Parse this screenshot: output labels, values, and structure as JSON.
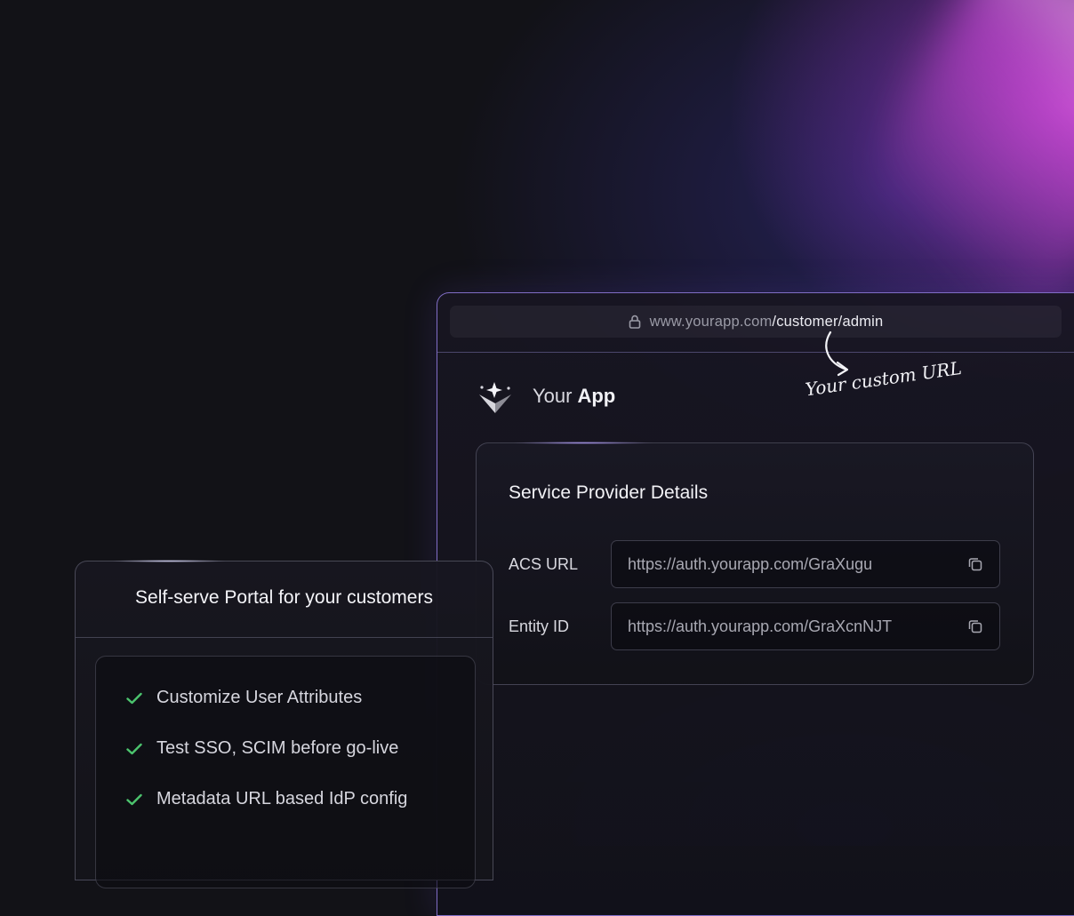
{
  "browser": {
    "url_host": "www.yourapp.com",
    "url_path": "/customer/admin",
    "annotation": "Your custom URL"
  },
  "brand": {
    "light": "Your",
    "bold": "App"
  },
  "service_provider": {
    "title": "Service Provider Details",
    "fields": [
      {
        "label": "ACS URL",
        "value": "https://auth.yourapp.com/GraXugu",
        "icon": "copy-icon"
      },
      {
        "label": "Entity ID",
        "value": "https://auth.yourapp.com/GraXcnNJT",
        "icon": "copy-icon"
      }
    ]
  },
  "portal": {
    "title": "Self-serve Portal for your customers",
    "features": [
      "Customize User Attributes",
      "Test SSO, SCIM before go-live",
      "Metadata URL based IdP config"
    ],
    "check_color": "#4cc46e"
  },
  "colors": {
    "accent_border": "#a58cff",
    "background": "#121217",
    "glow": "#f05aff"
  }
}
